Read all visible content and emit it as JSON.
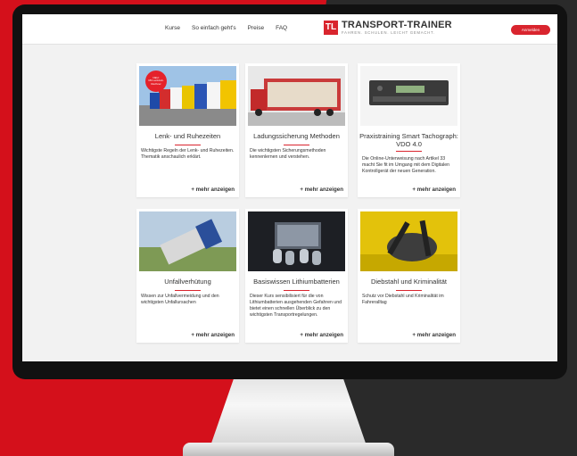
{
  "nav": {
    "items": [
      "Kurse",
      "So einfach geht's",
      "Preise",
      "FAQ"
    ]
  },
  "logo": {
    "mark": "TL",
    "title": "TRANSPORT-TRAINER",
    "subtitle": "FAHREN. SCHULEN. LEICHT GEMACHT."
  },
  "login_label": "Anmelden",
  "badge": {
    "line1": "NEU:",
    "line2": "Mit Lenkzeit-",
    "line3": "Rechner"
  },
  "more_label": "+ mehr anzeigen",
  "courses": [
    {
      "title": "Lenk- und Ruhezeiten",
      "desc": "Wichtigste Regeln der Lenk- und Ruhezeiten. Thematik anschaulich erklärt."
    },
    {
      "title": "Ladungssicherung Methoden",
      "desc": "Die wichtigsten Sicherungsmethoden kennenlernen und verstehen."
    },
    {
      "title": "Praxistraining Smart Tachograph: VDO 4.0",
      "desc": "Die Online-Unterweisung nach Artikel 33 macht Sie fit im Umgang mit dem Digitalen Kontrollgerät der neuen Generation."
    },
    {
      "title": "Unfallverhütung",
      "desc": "Wissen zur Unfallvermeidung und den wichtigsten Unfallursachen"
    },
    {
      "title": "Basiswissen Lithiumbatterien",
      "desc": "Dieser Kurs sensibilisiert für die von Lithiumbatterien ausgehenden Gefahren und bietet einen schnellen Überblick zu den wichtigsten Transportregelungen."
    },
    {
      "title": "Diebstahl und Kriminalität",
      "desc": "Schutz vor Diebstahl und Kriminalität im Fahreralltag"
    }
  ]
}
